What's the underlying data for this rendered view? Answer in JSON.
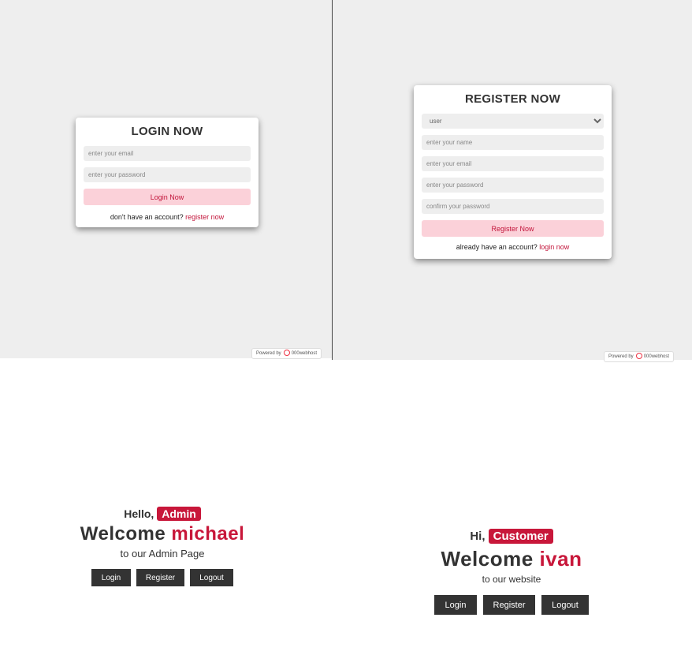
{
  "login_form": {
    "title": "LOGIN NOW",
    "email_placeholder": "enter your email",
    "password_placeholder": "enter your password",
    "submit_label": "Login Now",
    "footer_text": "don't have an account?",
    "footer_link": "register now"
  },
  "register_form": {
    "title": "REGISTER NOW",
    "user_type_selected": "user",
    "name_placeholder": "enter your name",
    "email_placeholder": "enter your email",
    "password_placeholder": "enter your password",
    "confirm_placeholder": "confirm your password",
    "submit_label": "Register Now",
    "footer_text": "already have an account?",
    "footer_link": "login now"
  },
  "powered_badge": {
    "prefix": "Powered by",
    "brand": "000webhost"
  },
  "admin_page": {
    "greeting": "Hello,",
    "role": "Admin",
    "welcome": "Welcome",
    "username": "michael",
    "subtitle": "to our Admin Page",
    "buttons": [
      "Login",
      "Register",
      "Logout"
    ]
  },
  "user_page": {
    "greeting": "Hi,",
    "role": "Customer",
    "welcome": "Welcome",
    "username": "ivan",
    "subtitle": "to our website",
    "buttons": [
      "Login",
      "Register",
      "Logout"
    ]
  },
  "colors": {
    "accent": "#c8173a",
    "pink_button": "#fbd1d9",
    "panel_bg": "#eeeeee",
    "dark_button": "#333333"
  }
}
